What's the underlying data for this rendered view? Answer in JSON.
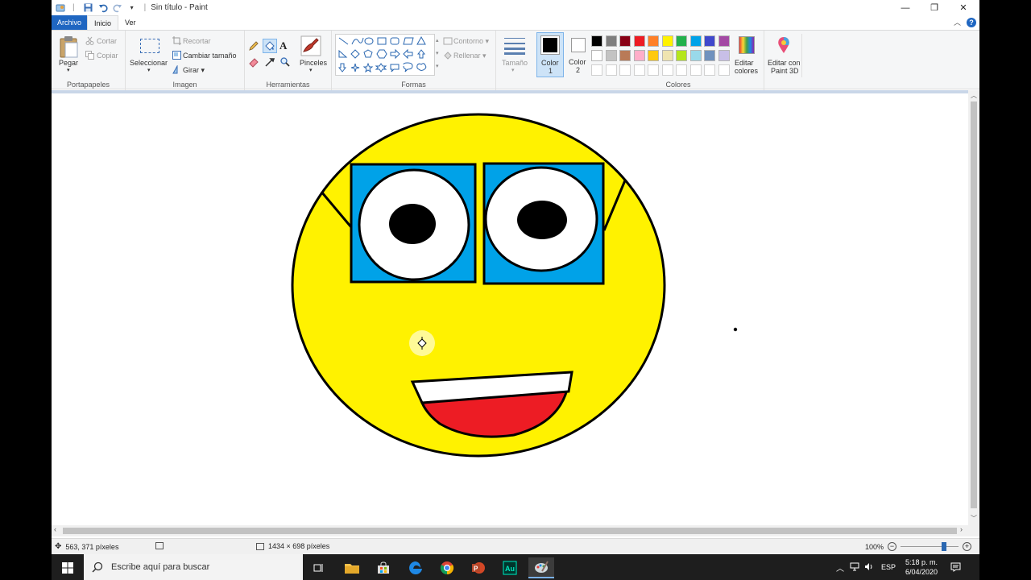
{
  "window": {
    "title": "Sin título - Paint",
    "controls": {
      "minimize": "—",
      "maximize": "❐",
      "close": "✕"
    }
  },
  "tabs": {
    "file": "Archivo",
    "home": "Inicio",
    "view": "Ver"
  },
  "ribbon": {
    "clipboard": {
      "paste": "Pegar",
      "cut": "Cortar",
      "copy": "Copiar",
      "group": "Portapapeles"
    },
    "image": {
      "select": "Seleccionar",
      "crop": "Recortar",
      "resize": "Cambiar tamaño",
      "rotate": "Girar",
      "group": "Imagen"
    },
    "tools": {
      "group": "Herramientas",
      "brushes": "Pinceles"
    },
    "shapes": {
      "outline": "Contorno",
      "fill": "Rellenar",
      "group": "Formas"
    },
    "size": {
      "label": "Tamaño"
    },
    "color1": {
      "label": "Color",
      "number": "1"
    },
    "color2": {
      "label": "Color",
      "number": "2"
    },
    "colors": {
      "group": "Colores",
      "palette_row1": [
        "#000000",
        "#7f7f7f",
        "#880015",
        "#ed1c24",
        "#ff7f27",
        "#fff200",
        "#22b14c",
        "#00a2e8",
        "#3f48cc",
        "#a349a4"
      ],
      "palette_row2": [
        "#ffffff",
        "#c3c3c3",
        "#b97a57",
        "#ffaec9",
        "#ffc90e",
        "#efe4b0",
        "#b5e61d",
        "#99d9ea",
        "#7092be",
        "#c8bfe7"
      ],
      "edit_line1": "Editar",
      "edit_line2": "colores",
      "paint3d_line1": "Editar con",
      "paint3d_line2": "Paint 3D"
    }
  },
  "status": {
    "cursor_pos": "563, 371 píxeles",
    "canvas_size": "1434 × 698 píxeles",
    "zoom": "100%",
    "zoom_fraction": 0.78
  },
  "taskbar": {
    "search_placeholder": "Escribe aquí para buscar",
    "language": "ESP",
    "time": "5:18 p. m.",
    "date": "6/04/2020"
  },
  "drawing": {
    "face_color": "#fff200",
    "glasses_color": "#00a2e8",
    "mouth_color": "#ed1c24"
  }
}
